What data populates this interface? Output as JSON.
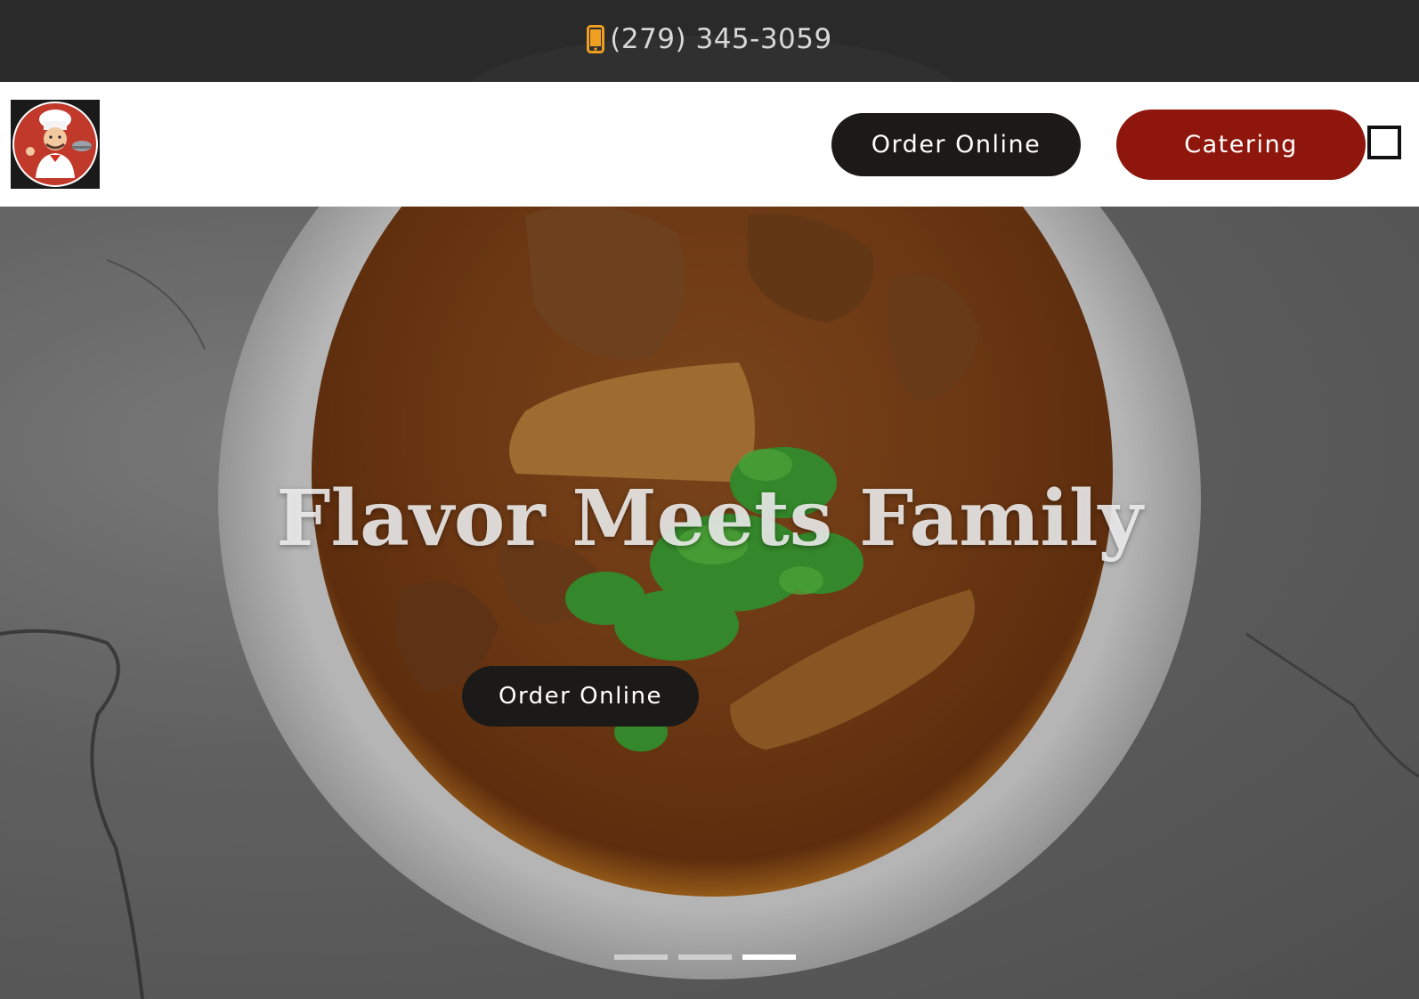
{
  "topbar": {
    "phone_icon": "mobile-phone-icon",
    "phone": "(279) 345-3059",
    "icon_color": "#f0a020"
  },
  "nav": {
    "logo_icon": "chef-mascot-logo",
    "order_label": "Order Online",
    "catering_label": "Catering",
    "menu_icon": "menu-toggle-icon",
    "order_color": "#1c1a18",
    "catering_color": "#8e160d"
  },
  "hero": {
    "title": "Flavor Meets Family",
    "cta_label": "Order Online",
    "image": "curry-bowl-photo",
    "slides": [
      {
        "active": false
      },
      {
        "active": false
      },
      {
        "active": true
      }
    ]
  }
}
